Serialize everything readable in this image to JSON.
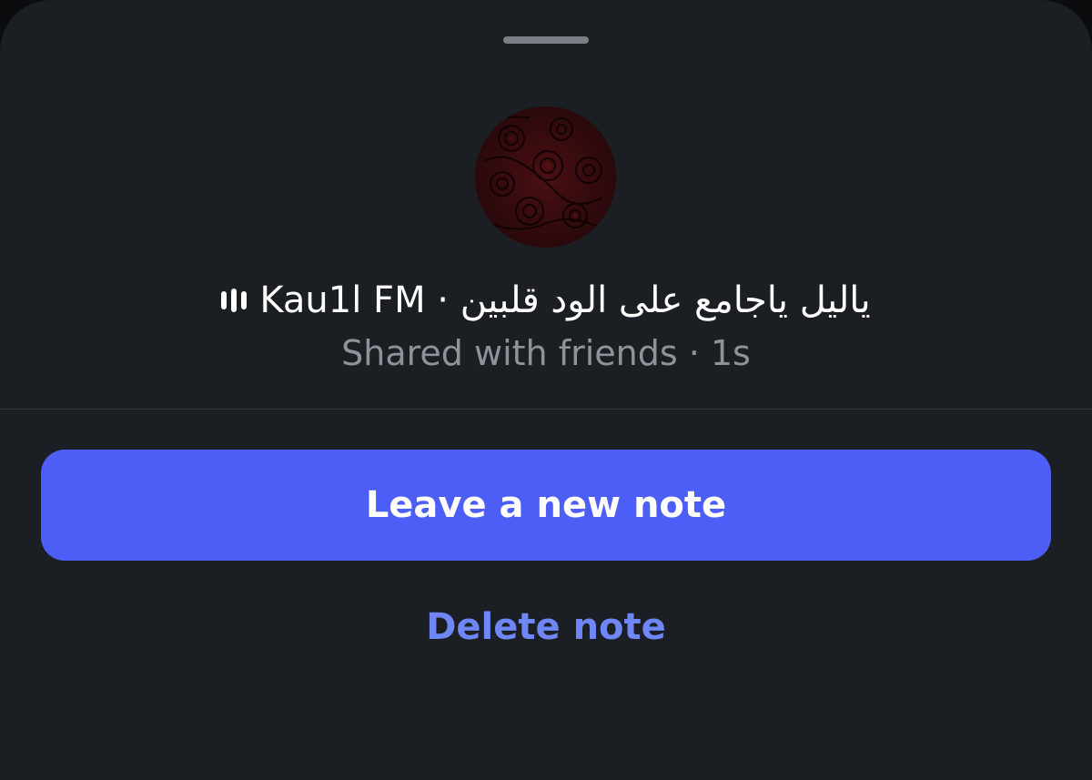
{
  "sheet": {
    "note": {
      "track_title": "ياليل ياجامع على الود قلبين",
      "separator": "·",
      "artist": "Kau1l FM",
      "subtitle": "Shared with friends · 1s",
      "icon": "music-bars-icon"
    },
    "actions": {
      "primary_label": "Leave a new note",
      "secondary_label": "Delete note"
    }
  },
  "colors": {
    "sheet_background": "#1b1e22",
    "primary_button": "#4d5ef7",
    "secondary_text": "#6f86f6",
    "subtitle_text": "#8e939a",
    "avatar_tint": "#5a1015"
  }
}
